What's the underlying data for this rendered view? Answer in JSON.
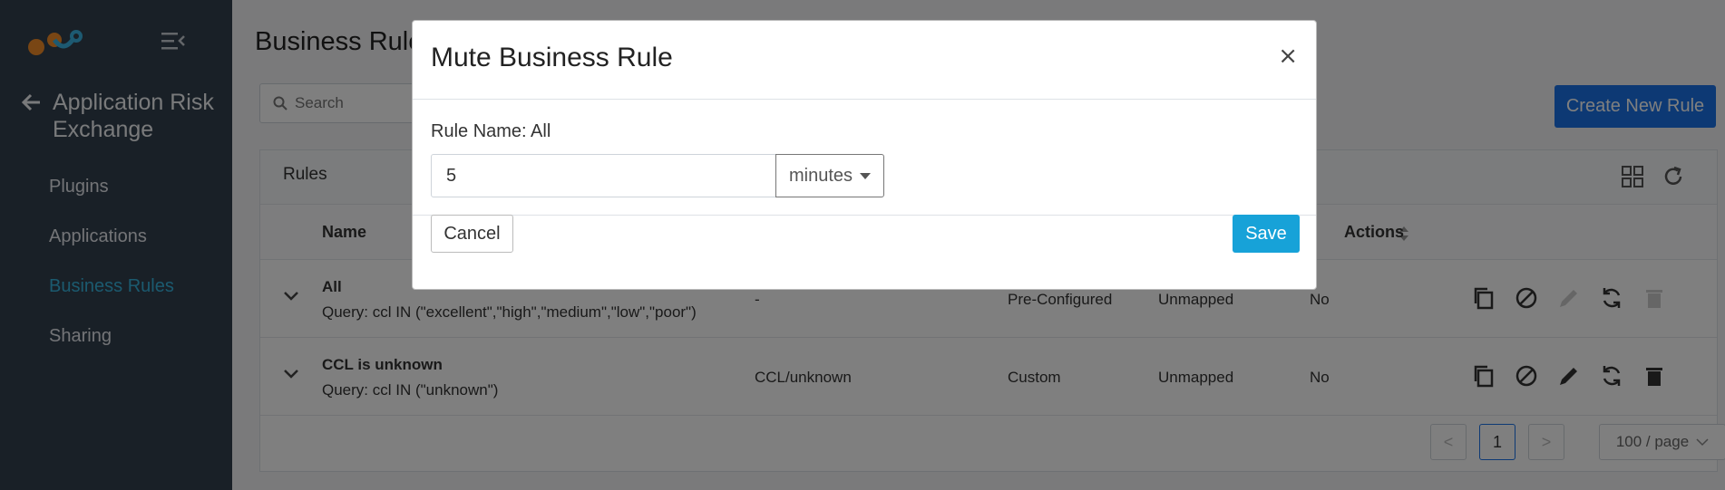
{
  "sidebar": {
    "app_title": "Application Risk Exchange",
    "items": [
      {
        "label": "Plugins"
      },
      {
        "label": "Applications"
      },
      {
        "label": "Business Rules"
      },
      {
        "label": "Sharing"
      }
    ],
    "active_item": "Business Rules"
  },
  "main": {
    "page_title": "Business Rules",
    "search_placeholder": "Search",
    "create_button": "Create New Rule",
    "card_title": "Rules",
    "columns": {
      "name": "Name",
      "actions": "Actions"
    },
    "rows": [
      {
        "name": "All",
        "query": "Query: ccl IN (\"excellent\",\"high\",\"medium\",\"low\",\"poor\")",
        "tag": "-",
        "type": "Pre-Configured",
        "mapping": "Unmapped",
        "muted": "No"
      },
      {
        "name": "CCL is unknown",
        "query": "Query: ccl IN (\"unknown\")",
        "tag": "CCL/unknown",
        "type": "Custom",
        "mapping": "Unmapped",
        "muted": "No"
      }
    ],
    "pagination": {
      "prev": "<",
      "current": "1",
      "next": ">",
      "page_size": "100 / page"
    }
  },
  "modal": {
    "title": "Mute Business Rule",
    "close": "×",
    "rule_label": "Rule Name: All",
    "duration_value": "5",
    "duration_unit": "minutes",
    "cancel": "Cancel",
    "save": "Save"
  },
  "colors": {
    "sidebar_bg": "#33404f",
    "active_nav": "#36b4df",
    "primary": "#1a73e8",
    "save": "#17a2d8"
  }
}
